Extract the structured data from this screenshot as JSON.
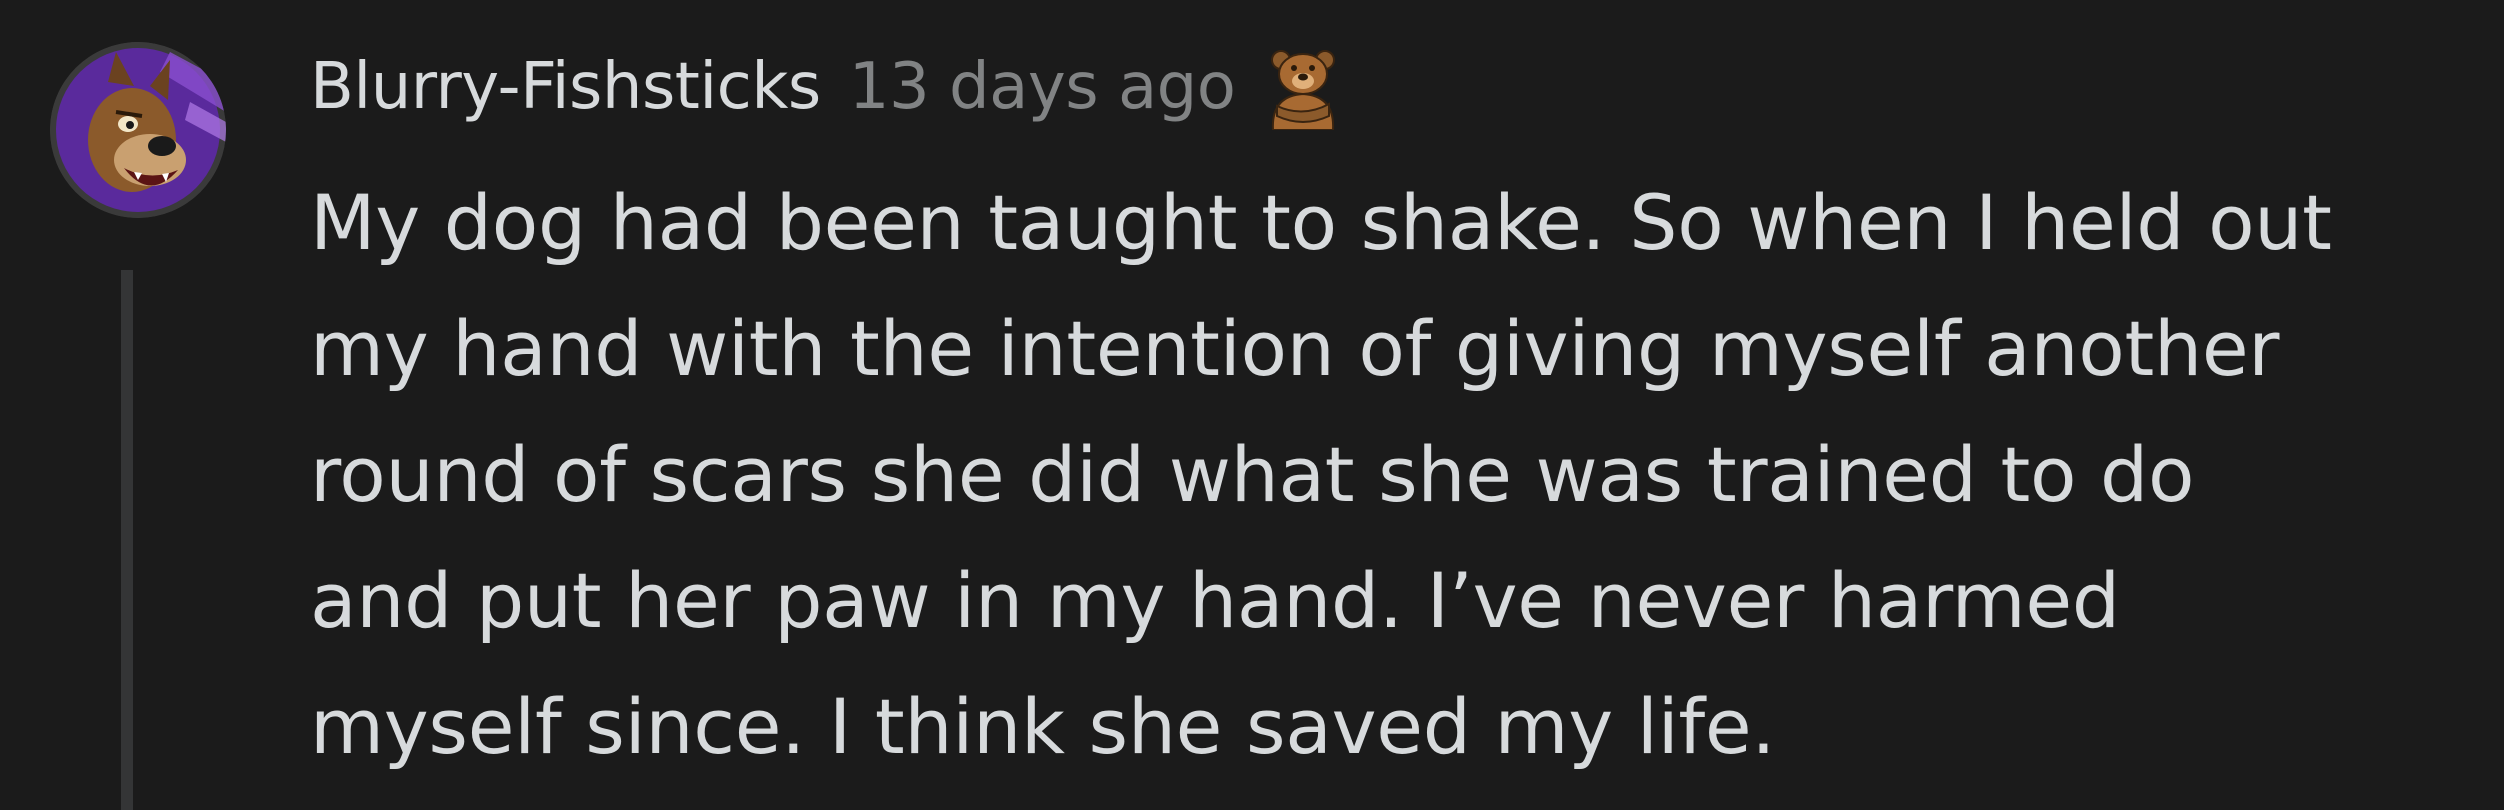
{
  "comment": {
    "username": "Blurry-Fishsticks",
    "timestamp": "13 days ago",
    "flair_icon": "bear-arms-crossed-icon",
    "body_lines": [
      "My dog had been taught to shake. So when I held out",
      "my hand with the intention of giving myself another",
      "round of scars she did what she was trained to do",
      "and put her paw in my hand. I’ve never harmed",
      "myself since. I think she saved my life."
    ]
  },
  "avatar": {
    "icon": "cartoon-dog-avatar",
    "background_color": "#5a2a9c"
  },
  "colors": {
    "background": "#1b1b1b",
    "text": "#d7dadc",
    "meta": "#818384",
    "thread_line": "#343536"
  }
}
